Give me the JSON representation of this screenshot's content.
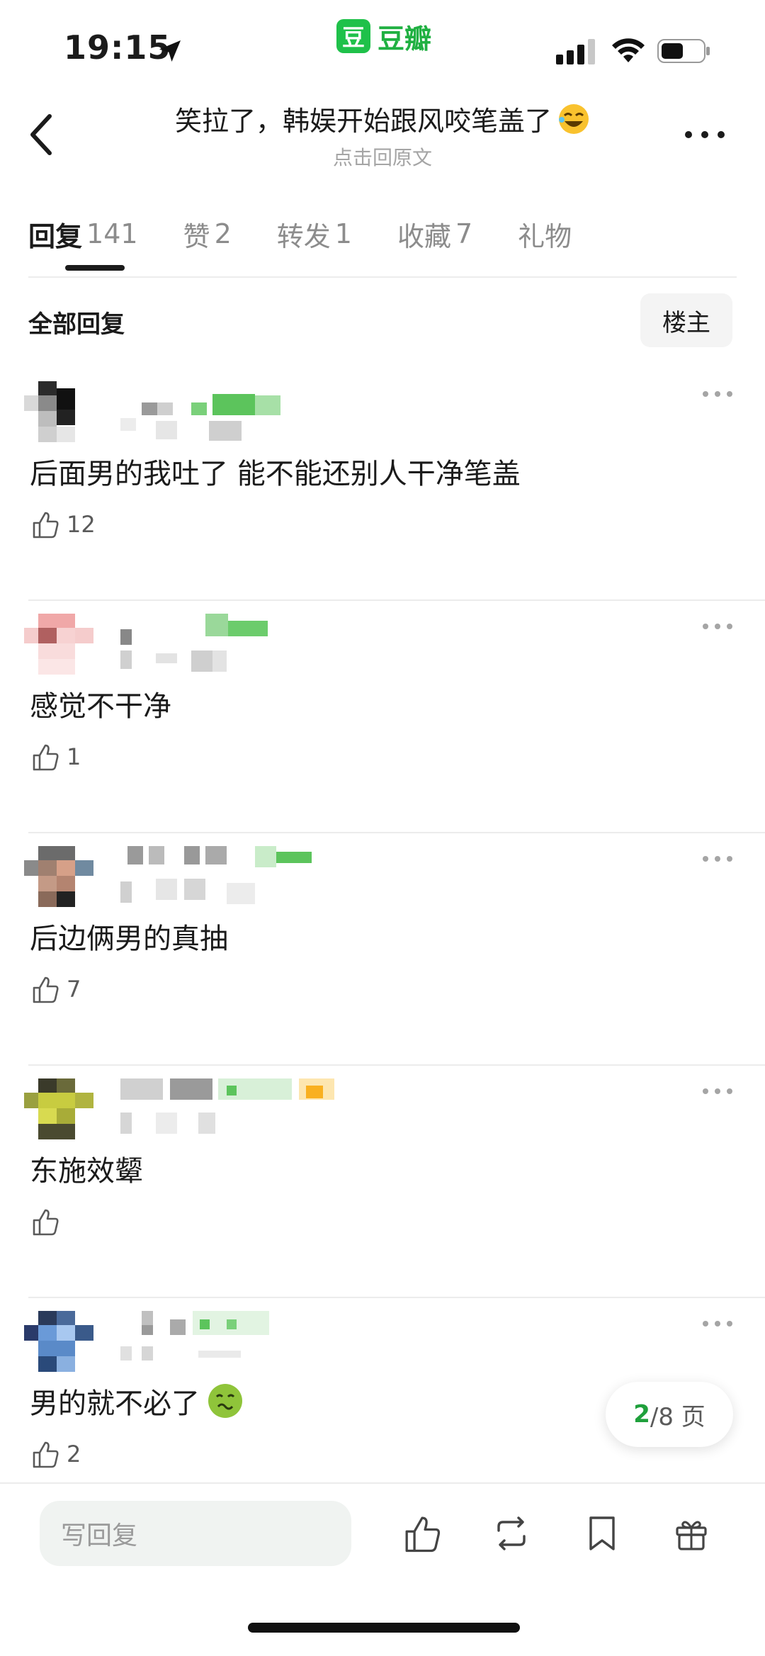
{
  "status_bar": {
    "time": "19:15",
    "app_logo": "豆",
    "app_name": "豆瓣"
  },
  "header": {
    "title": "笑拉了，韩娱开始跟风咬笔盖了",
    "subtitle": "点击回原文"
  },
  "tabs": [
    {
      "label": "回复",
      "count": "141",
      "active": true
    },
    {
      "label": "赞",
      "count": "2",
      "active": false
    },
    {
      "label": "转发",
      "count": "1",
      "active": false
    },
    {
      "label": "收藏",
      "count": "7",
      "active": false
    },
    {
      "label": "礼物",
      "count": "",
      "active": false
    }
  ],
  "replies_section": {
    "title": "全部回复",
    "filter_button": "楼主"
  },
  "replies": [
    {
      "content": "后面男的我吐了 能不能还别人干净笔盖",
      "likes": "12"
    },
    {
      "content": "感觉不干净",
      "likes": "1"
    },
    {
      "content": "后边俩男的真抽",
      "likes": "7"
    },
    {
      "content": "东施效颦",
      "likes": ""
    },
    {
      "content": "男的就不必了",
      "likes": "2"
    }
  ],
  "pagination": {
    "current": "2",
    "total_label": "/8 页"
  },
  "bottom_bar": {
    "input_placeholder": "写回复"
  },
  "colors": {
    "brand_green": "#1fc14a",
    "text": "#1b1b1b",
    "muted": "#8c8c8c"
  }
}
